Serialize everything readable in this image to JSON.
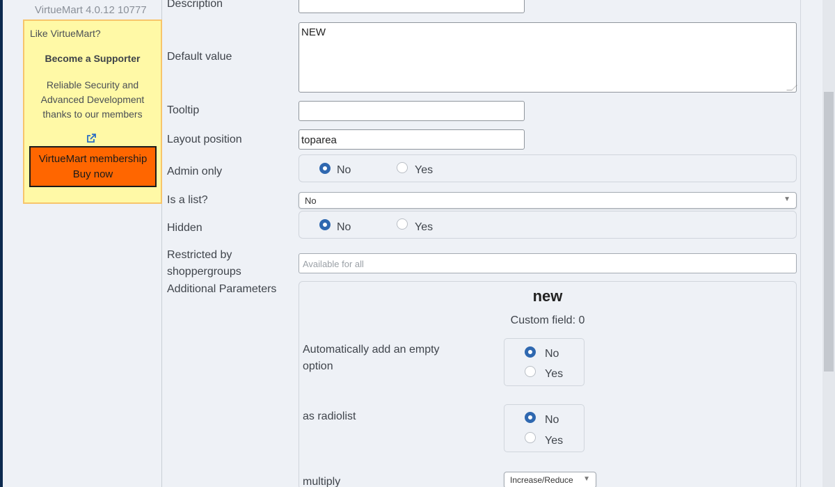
{
  "sidebar": {
    "version": "VirtueMart 4.0.12 10777",
    "promo": {
      "heading": "Like VirtueMart?",
      "title": "Become a Supporter",
      "body_line1": "Reliable Security and",
      "body_line2": "Advanced Development",
      "body_line3": "thanks to our members",
      "external_icon": "external-link-icon",
      "button_line1": "VirtueMart membership",
      "button_line2": "Buy now"
    }
  },
  "form": {
    "description": {
      "label": "Description",
      "value": ""
    },
    "default_value": {
      "label": "Default value",
      "value": "NEW"
    },
    "tooltip": {
      "label": "Tooltip",
      "value": ""
    },
    "layout_position": {
      "label": "Layout position",
      "value": "toparea"
    },
    "admin_only": {
      "label": "Admin only",
      "options": [
        "No",
        "Yes"
      ],
      "selected": "No"
    },
    "is_list": {
      "label": "Is a list?",
      "selected": "No"
    },
    "hidden": {
      "label": "Hidden",
      "options": [
        "No",
        "Yes"
      ],
      "selected": "No"
    },
    "restricted": {
      "label_line1": "Restricted by",
      "label_line2": "shoppergroups",
      "placeholder": "Available for all"
    },
    "additional": {
      "label": "Additional Parameters"
    }
  },
  "params": {
    "title": "new",
    "subtitle": "Custom field: 0",
    "auto_empty": {
      "label_line1": "Automatically add an empty",
      "label_line2": "option",
      "options": [
        "No",
        "Yes"
      ],
      "selected": "No"
    },
    "radiolist": {
      "label": "as radiolist",
      "options": [
        "No",
        "Yes"
      ],
      "selected": "No"
    },
    "multiply": {
      "label": "multiply",
      "selected": "Increase/Reduce"
    }
  },
  "colors": {
    "accent": "#2f68b0",
    "promo_bg": "#fff9a6",
    "buy_button": "#ff6600"
  }
}
